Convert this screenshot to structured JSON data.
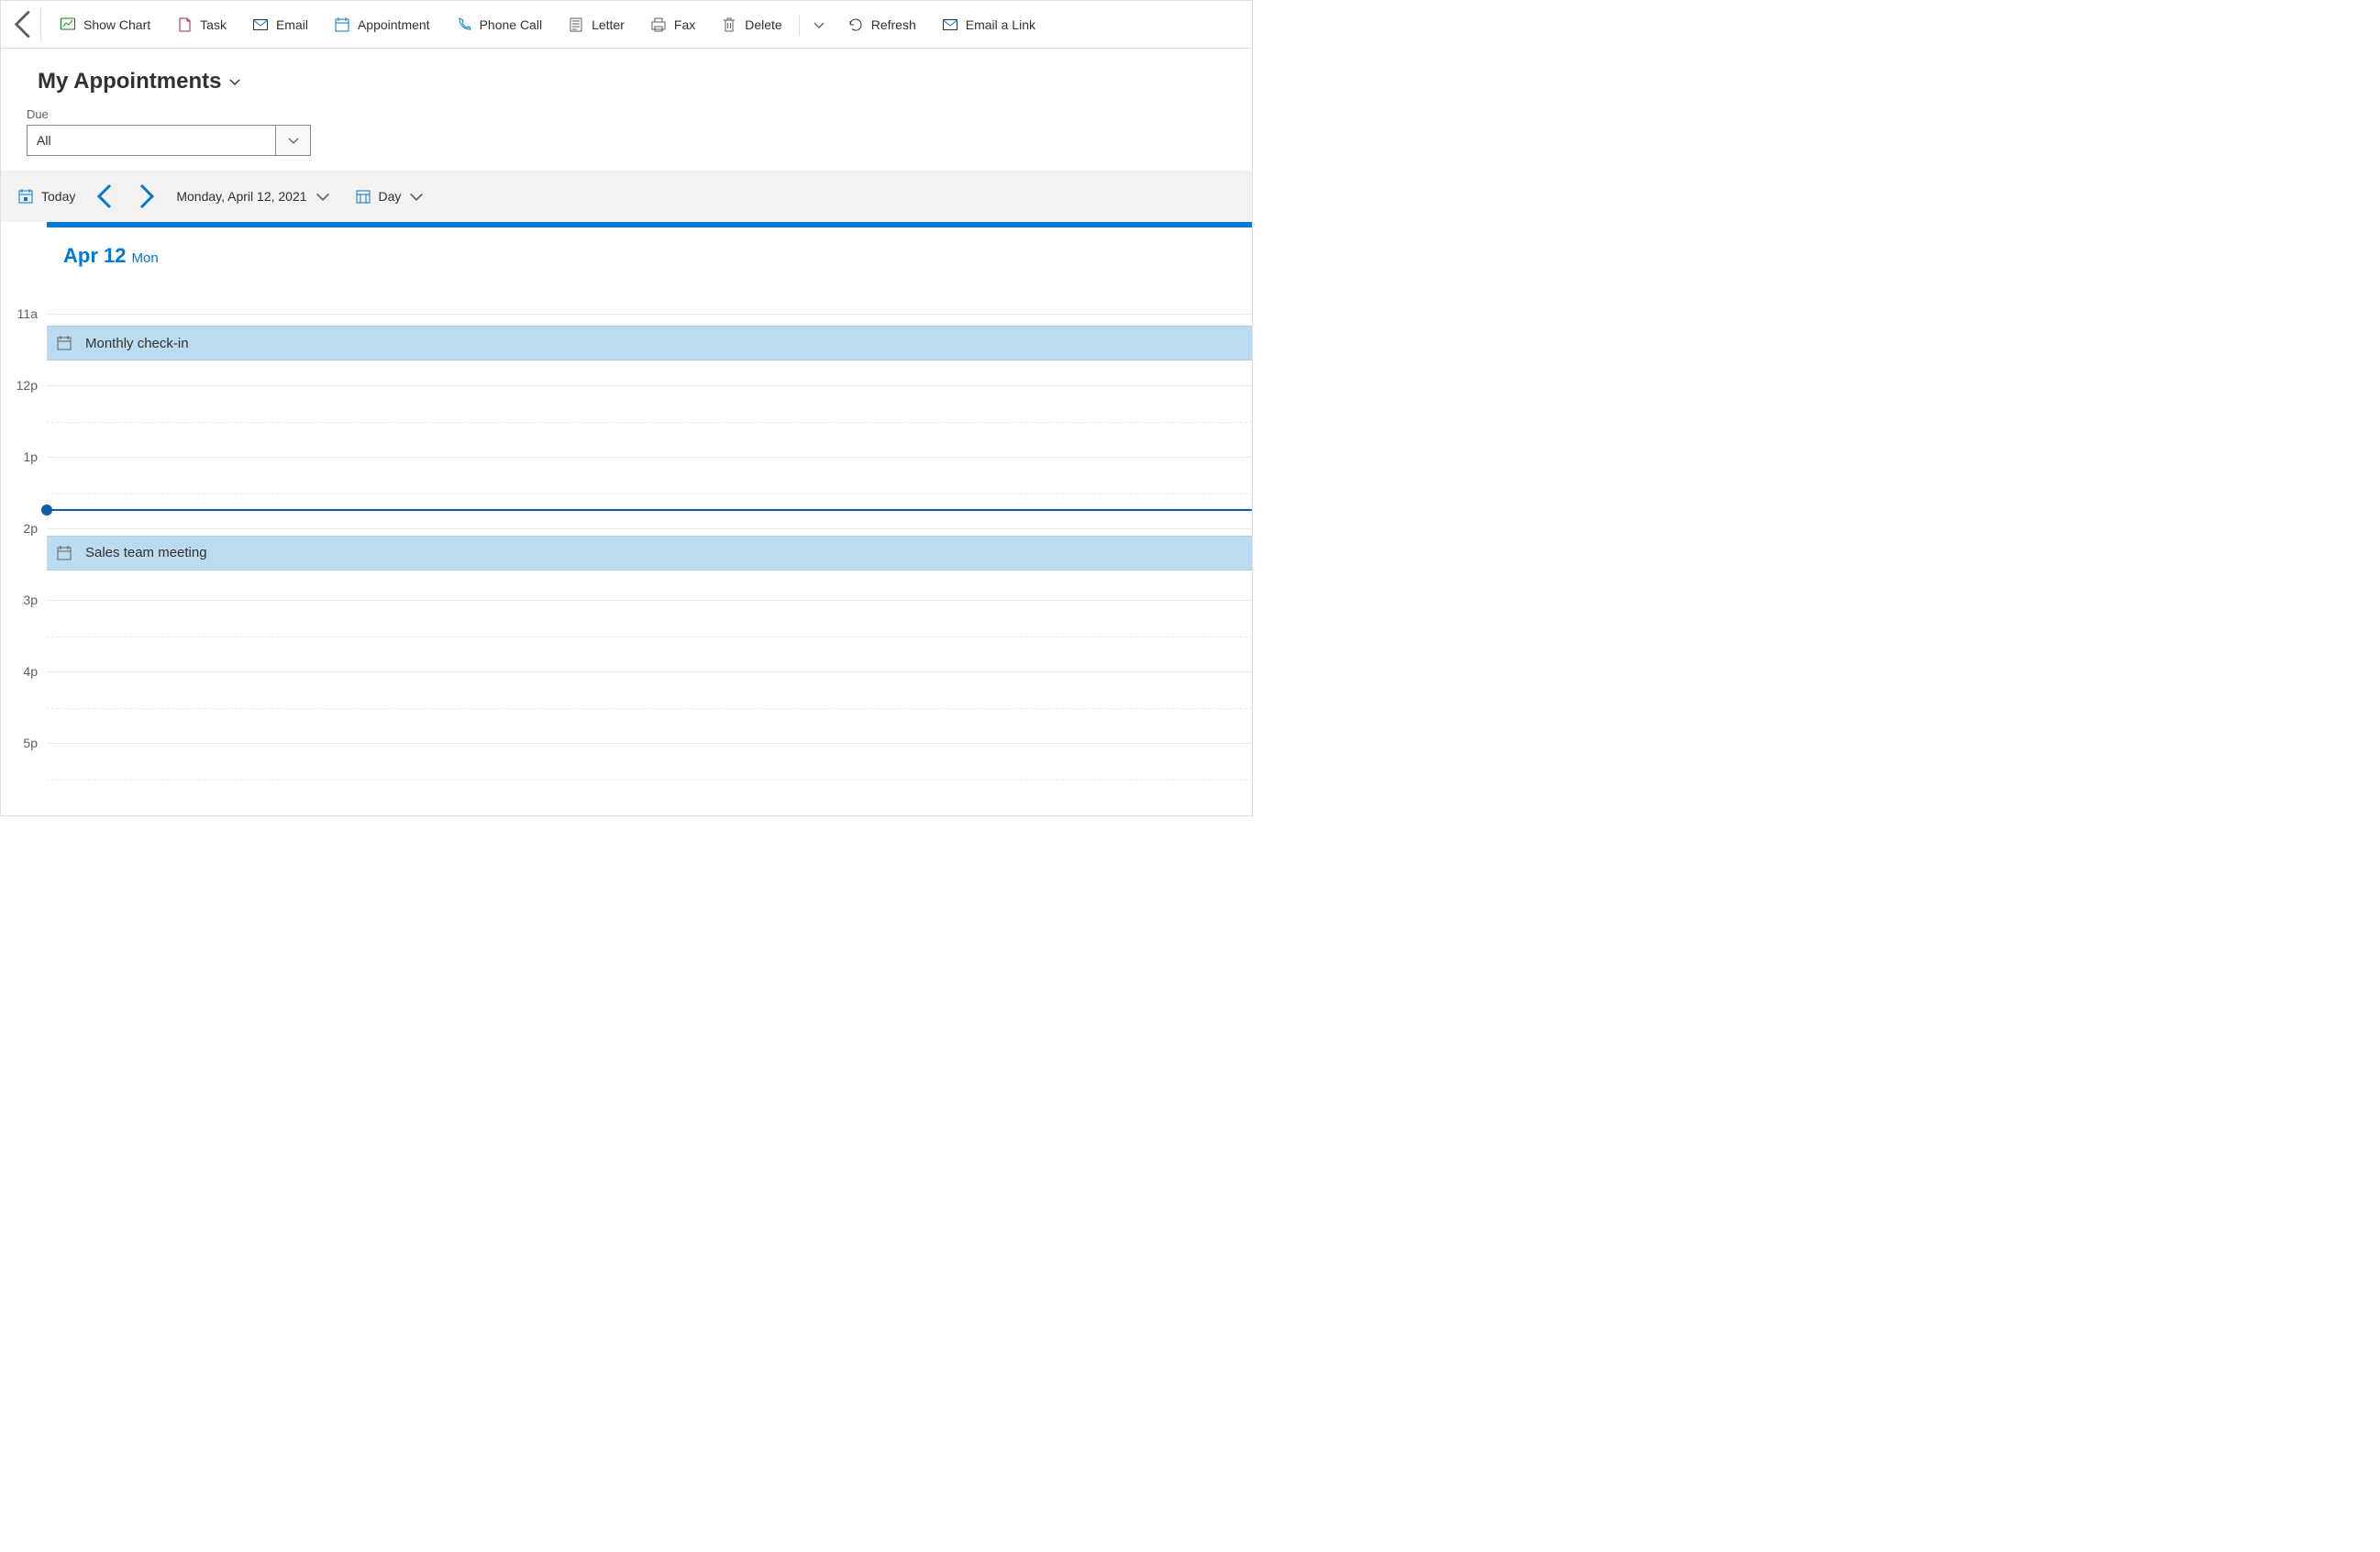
{
  "commandBar": {
    "showChart": "Show Chart",
    "task": "Task",
    "email": "Email",
    "appointment": "Appointment",
    "phoneCall": "Phone Call",
    "letter": "Letter",
    "fax": "Fax",
    "delete": "Delete",
    "refresh": "Refresh",
    "emailLink": "Email a Link"
  },
  "view": {
    "title": "My Appointments"
  },
  "filter": {
    "label": "Due",
    "value": "All"
  },
  "calendarNav": {
    "today": "Today",
    "dateLabel": "Monday, April 12, 2021",
    "viewMode": "Day"
  },
  "dayHeader": {
    "date": "Apr 12",
    "dow": "Mon"
  },
  "timeSlots": [
    "11a",
    "12p",
    "1p",
    "2p",
    "3p",
    "4p",
    "5p"
  ],
  "events": [
    {
      "title": "Monthly check-in",
      "slotIndex": 0,
      "offsetWithinSlot": 0.17
    },
    {
      "title": "Sales team meeting",
      "slotIndex": 3,
      "offsetWithinSlot": 0.1
    }
  ],
  "nowIndicator": {
    "slotIndex": 2,
    "offsetWithinSlot": 0.73
  }
}
